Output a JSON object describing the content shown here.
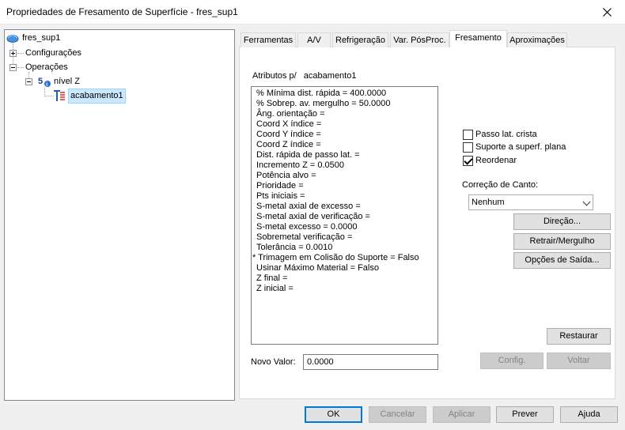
{
  "window": {
    "title": "Propriedades de Fresamento de Superfície - fres_sup1",
    "close_glyph": "✕"
  },
  "tree": {
    "root": "fres_sup1",
    "configuracoes": "Configurações",
    "operacoes": "Operações",
    "nivel_z": "nível Z",
    "acabamento": "acabamento1"
  },
  "tabs": [
    "Ferramentas",
    "A/V",
    "Refrigeração",
    "Var. PósProc.",
    "Fresamento",
    "Aproximações"
  ],
  "active_tab": "Fresamento",
  "attributes": {
    "label": "Atributos p/   acabamento1",
    "items": [
      "% Mínima dist. rápida = 400.0000",
      "% Sobrep. av. mergulho = 50.0000",
      "Âng. orientação =",
      "Coord X índice =",
      "Coord Y índice =",
      "Coord Z índice =",
      "Dist. rápida de passo lat. =",
      "Incremento Z = 0.0500",
      "Potência alvo =",
      "Prioridade =",
      "Pts iniciais =",
      "S-metal axial de excesso =",
      "S-metal axial de verificação =",
      "S-metal excesso = 0.0000",
      "Sobremetal verificação =",
      "Tolerância = 0.0010",
      "* Trimagem em Colisão do Suporte = Falso",
      "Usinar Máximo Material = Falso",
      "Z final =",
      "Z inicial ="
    ]
  },
  "options": {
    "passo_lat": {
      "label": "Passo lat. crista",
      "checked": false
    },
    "suporte": {
      "label": "Suporte a superf. plana",
      "checked": false
    },
    "reordenar": {
      "label": "Reordenar",
      "checked": true
    }
  },
  "correcao": {
    "label": "Correção de Canto:",
    "value": "Nenhum"
  },
  "buttons": {
    "direcao": "Direção...",
    "retrair": "Retrair/Mergulho",
    "opcoes_saida": "Opções de Saída...",
    "restaurar": "Restaurar",
    "config": "Config.",
    "voltar": "Voltar",
    "ok": "OK",
    "cancelar": "Cancelar",
    "aplicar": "Aplicar",
    "prever": "Prever",
    "ajuda": "Ajuda"
  },
  "novo_valor": {
    "label": "Novo Valor:",
    "value": "0.0000"
  }
}
